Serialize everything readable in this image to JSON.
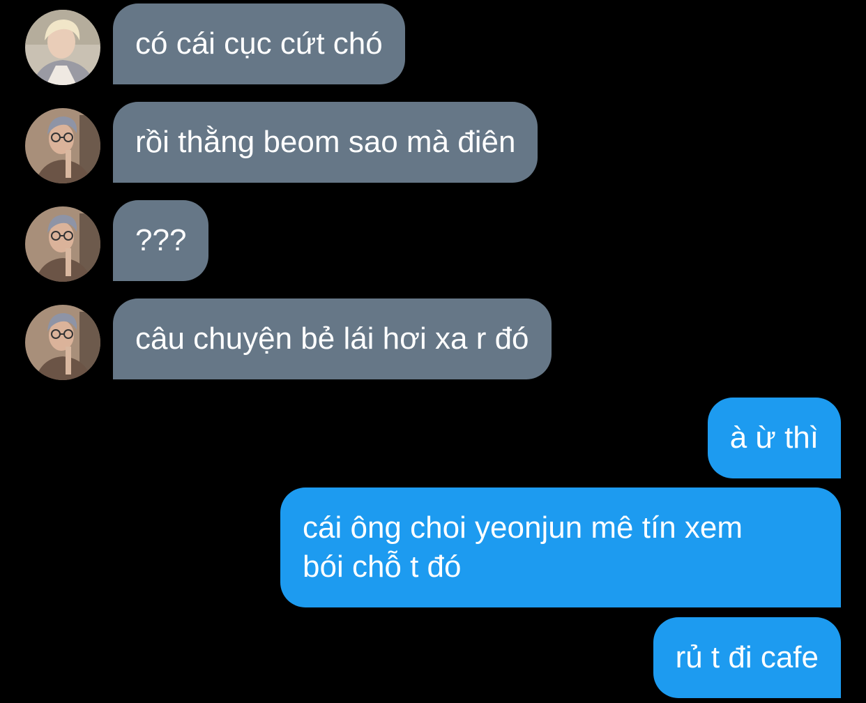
{
  "conversation": {
    "incoming": [
      {
        "avatar": "blond-person-avatar",
        "text": "có cái cục cứt chó"
      },
      {
        "avatar": "glasses-person-avatar",
        "text": "rồi thằng beom sao mà điên"
      },
      {
        "avatar": "glasses-person-avatar",
        "text": "???"
      },
      {
        "avatar": "glasses-person-avatar",
        "text": "câu chuyện bẻ lái hơi xa r đó"
      }
    ],
    "outgoing": [
      {
        "text": "à ừ thì"
      },
      {
        "lines": [
          "cái ông choi yeonjun mê tín xem",
          "bói chỗ t đó"
        ]
      },
      {
        "text": "rủ t đi cafe"
      }
    ]
  },
  "colors": {
    "background": "#000000",
    "incoming_bubble": "#667787",
    "outgoing_bubble": "#1d9bf0",
    "text": "#ffffff"
  }
}
